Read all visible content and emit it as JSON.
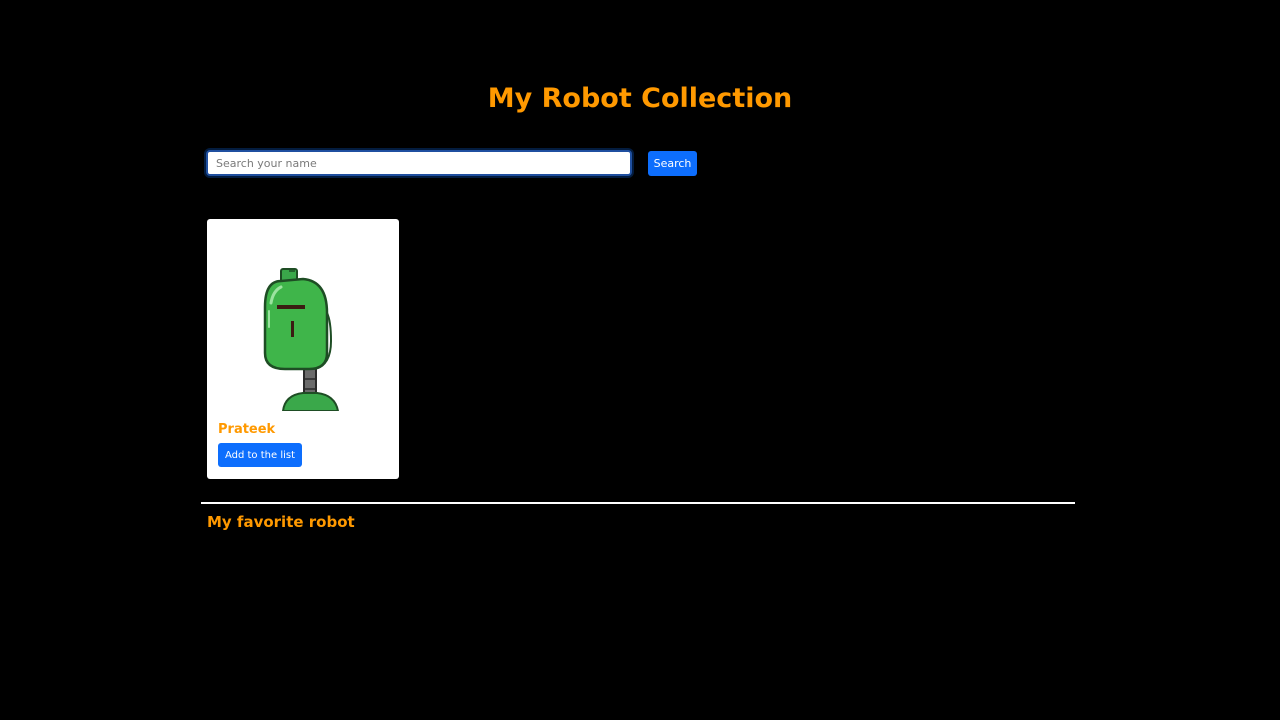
{
  "header": {
    "title": "My Robot Collection"
  },
  "search": {
    "placeholder": "Search your name",
    "value": "",
    "button_label": "Search"
  },
  "robots": [
    {
      "name": "Prateek",
      "image_icon": "green-robot-avatar",
      "add_button_label": "Add to the list"
    }
  ],
  "favorites": {
    "heading": "My favorite robot",
    "items": []
  },
  "colors": {
    "background": "#000000",
    "accent": "#ff9900",
    "primary_button": "#0d6efd",
    "card_background": "#ffffff"
  }
}
